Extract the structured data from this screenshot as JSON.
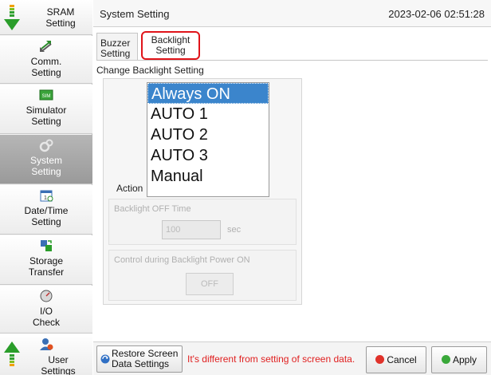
{
  "sidebar": {
    "items": [
      {
        "label_line1": "SRAM",
        "label_line2": "Setting",
        "icon": "sram-icon"
      },
      {
        "label_line1": "Comm.",
        "label_line2": "Setting",
        "icon": "comm-icon"
      },
      {
        "label_line1": "Simulator",
        "label_line2": "Setting",
        "icon": "simulator-icon"
      },
      {
        "label_line1": "System",
        "label_line2": "Setting",
        "icon": "gear-icon"
      },
      {
        "label_line1": "Date/Time",
        "label_line2": "Setting",
        "icon": "calendar-icon"
      },
      {
        "label_line1": "Storage",
        "label_line2": "Transfer",
        "icon": "storage-icon"
      },
      {
        "label_line1": "I/O",
        "label_line2": "Check",
        "icon": "gauge-icon"
      },
      {
        "label_line1": "User",
        "label_line2": "Settings",
        "icon": "user-icon"
      }
    ]
  },
  "header": {
    "title": "System Setting",
    "datetime": "2023-02-06 02:51:28"
  },
  "tabs": [
    {
      "line1": "Buzzer",
      "line2": "Setting"
    },
    {
      "line1": "Backlight",
      "line2": "Setting"
    }
  ],
  "section_title": "Change Backlight Setting",
  "action": {
    "label": "Action",
    "options": [
      "Always ON",
      "AUTO 1",
      "AUTO 2",
      "AUTO 3",
      "Manual"
    ],
    "selected": "Always ON"
  },
  "backlight_off_time": {
    "caption": "Backlight OFF Time",
    "value": "100",
    "unit": "sec"
  },
  "control_power_on": {
    "caption": "Control during Backlight Power ON",
    "button": "OFF"
  },
  "bottom": {
    "restore_line1": "Restore Screen",
    "restore_line2": "Data Settings",
    "warning": "It's different from setting of screen data.",
    "cancel": "Cancel",
    "apply": "Apply"
  },
  "colors": {
    "selected": "#3b85cc",
    "warning": "#e02020",
    "highlight": "#e0141a",
    "active_tab_bg": "#a8a8a8"
  }
}
